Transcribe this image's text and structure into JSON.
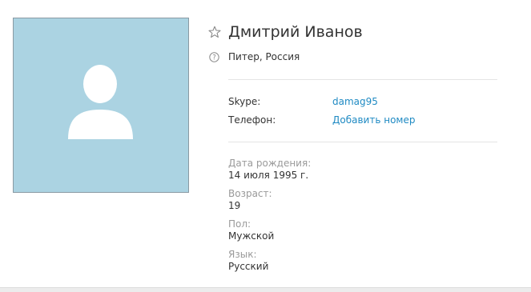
{
  "profile": {
    "name": "Дмитрий Иванов",
    "location": "Питер, Россия",
    "favorite_icon": "star-outline-icon",
    "location_icon": "question-circle-icon",
    "avatar_placeholder_color": "#abd3e2"
  },
  "contacts": {
    "skype_label": "Skype:",
    "skype_value": "damag95",
    "phone_label": "Телефон:",
    "phone_value": "Добавить номер"
  },
  "details": {
    "birthday_label": "Дата рождения:",
    "birthday_value": "14 июля 1995 г.",
    "age_label": "Возраст:",
    "age_value": "19",
    "gender_label": "Пол:",
    "gender_value": "Мужской",
    "language_label": "Язык:",
    "language_value": "Русский"
  },
  "colors": {
    "link": "#1f8ac3",
    "muted_label": "#9a9a9a",
    "text": "#333333"
  }
}
